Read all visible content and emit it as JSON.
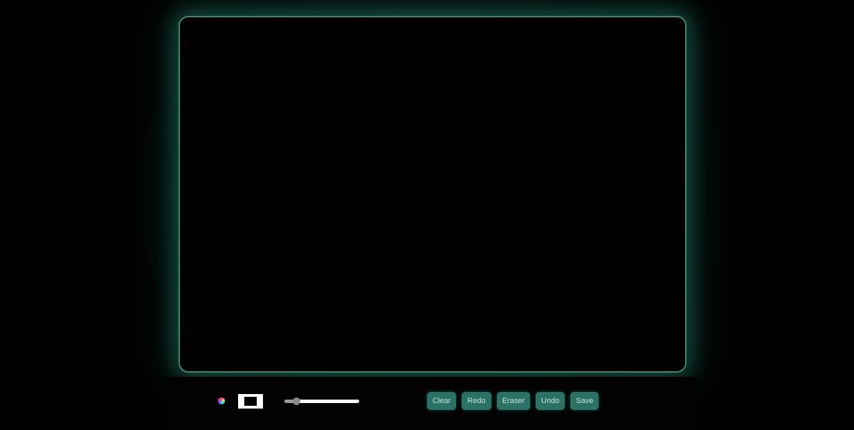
{
  "toolbar": {
    "pen_color_icon": "color-wheel-icon",
    "background_swatch": {
      "outer_color": "#ffffff",
      "inner_color": "#000000"
    },
    "brush_size": {
      "fraction": 0.16
    },
    "buttons": [
      {
        "label": "Clear"
      },
      {
        "label": "Redo"
      },
      {
        "label": "Eraser"
      },
      {
        "label": "Undo"
      },
      {
        "label": "Save"
      }
    ]
  },
  "colors": {
    "page_background": "#000000",
    "canvas_border": "#3e8a6c",
    "glow": "#2a8c73",
    "button_background": "#2b7266",
    "button_text": "#c9e6df"
  }
}
